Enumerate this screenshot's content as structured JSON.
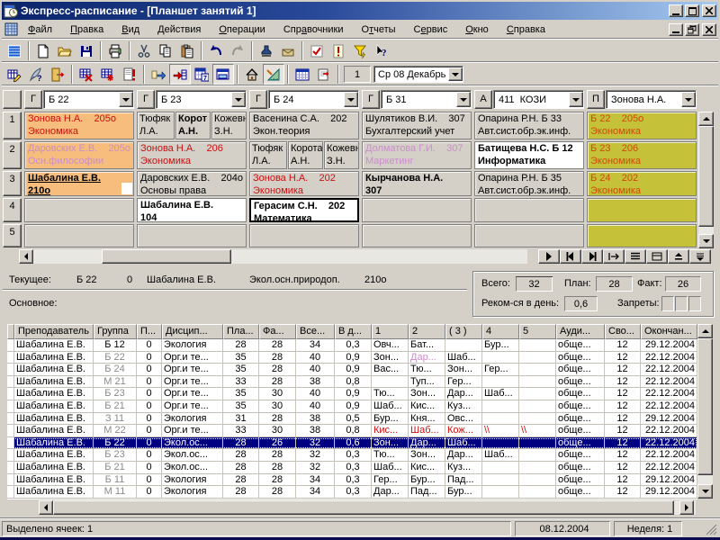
{
  "titlebar": {
    "title": "Экспресс-расписание - [Планшет занятий 1]",
    "icon": "app-icon",
    "buttons": [
      "minimize-button",
      "maximize-button",
      "close-button"
    ]
  },
  "menubar": {
    "icon": "child-window-icon",
    "items": [
      {
        "label": "Файл",
        "hot": 0
      },
      {
        "label": "Правка",
        "hot": 0
      },
      {
        "label": "Вид",
        "hot": 0
      },
      {
        "label": "Действия",
        "hot": 0
      },
      {
        "label": "Операции",
        "hot": 0
      },
      {
        "label": "Справочники",
        "hot": 3
      },
      {
        "label": "Отчеты",
        "hot": 1
      },
      {
        "label": "Сервис",
        "hot": 1
      },
      {
        "label": "Окно",
        "hot": 0
      },
      {
        "label": "Справка",
        "hot": 0
      }
    ],
    "mdi_buttons": [
      "mdi-minimize-button",
      "mdi-restore-button",
      "mdi-close-button"
    ]
  },
  "toolbar_main": {
    "icons": [
      "view-list-icon",
      "|",
      "new-document-icon",
      "open-folder-icon",
      "save-icon",
      "|",
      "print-icon",
      "|",
      "cut-icon",
      "copy-icon",
      "paste-icon",
      "|",
      "undo-icon",
      "redo-icon",
      "|",
      "stamp-icon",
      "send-icon",
      "|",
      "check-task-icon",
      "alert-doc-icon",
      "filter-icon",
      "help-pointer-icon"
    ]
  },
  "toolbar_schedule": {
    "icons": [
      "grid-edit-icon",
      "quill-icon",
      "exit-door-icon",
      "|",
      "grid-delete-icon",
      "grid-clear-icon",
      "doc-warning-icon",
      "|",
      "move-lesson-icon",
      "move-lesson-next-icon*",
      "calendar-day-icon",
      "window-panel-icon*",
      "|",
      "home-icon",
      "ruler-icon*",
      "|",
      "calendar-grid-icon",
      "sheet-settings-icon",
      "|"
    ],
    "lesson_number": "1",
    "date_value": "Ср 08 Декабрь"
  },
  "schedule": {
    "columns": [
      {
        "btn": "Г",
        "value": "Б 22"
      },
      {
        "btn": "Г",
        "value": "Б 23"
      },
      {
        "btn": "Г",
        "value": "Б 24"
      },
      {
        "btn": "Г",
        "value": "Б 31"
      },
      {
        "btn": "А",
        "value": "411  КОЗИ"
      },
      {
        "btn": "П",
        "value": "Зонова Н.А."
      }
    ],
    "rows": [
      {
        "num": "1",
        "cells": [
          {
            "lines": [
              "Зонова Н.А.    205о",
              "Экономика"
            ],
            "bg": "peach",
            "fg": "red"
          },
          {
            "split": [
              {
                "lines": [
                  "Тюфяк",
                  "Л.А."
                ]
              },
              {
                "lines": [
                  "Корот",
                  "А.Н."
                ],
                "bold": true
              },
              {
                "lines": [
                  "Кожевн",
                  "З.Н."
                ]
              }
            ]
          },
          {
            "lines": [
              "Васенина С.А.    202",
              "Экон.теория"
            ]
          },
          {
            "lines": [
              "Шулятиков В.И.    307",
              "Бухгалтерский учет"
            ]
          },
          {
            "lines": [
              "Опарина Р.Н. Б 33",
              "Авт.сист.обр.эк.инф."
            ]
          },
          {
            "lines": [
              "Б 22    205о",
              "Экономика"
            ],
            "bg": "olive",
            "fg": "rust"
          }
        ]
      },
      {
        "num": "2",
        "cells": [
          {
            "lines": [
              "Даровских Е.В.    205о",
              "Осн.философии"
            ],
            "bg": "peach",
            "fg": "pink"
          },
          {
            "lines": [
              "Зонова Н.А.    206",
              "Экономика"
            ],
            "fg": "red"
          },
          {
            "split": [
              {
                "lines": [
                  "Тюфяк",
                  "Л.А."
                ]
              },
              {
                "lines": [
                  "Корота",
                  "А.Н."
                ]
              },
              {
                "lines": [
                  "Кожевн",
                  "З.Н."
                ]
              }
            ]
          },
          {
            "lines": [
              "Долматова Г.И.    307",
              "Маркетинг"
            ],
            "fg": "pink"
          },
          {
            "lines": [
              "Батищева Н.С. Б 12",
              "Информатика"
            ],
            "bg": "white",
            "bold": true
          },
          {
            "lines": [
              "Б 23    206",
              "Экономика"
            ],
            "bg": "olive",
            "fg": "rust"
          }
        ]
      },
      {
        "num": "3",
        "cells": [
          {
            "lines": [
              "Шабалина Е.В.",
              "210о"
            ],
            "bg": "peach",
            "bold": true,
            "underline": true,
            "marker": true
          },
          {
            "lines": [
              "Даровских Е.В.    204о",
              "Основы права"
            ]
          },
          {
            "lines": [
              "Зонова Н.А.    202",
              "Экономика"
            ],
            "fg": "red"
          },
          {
            "lines": [
              "Кырчанова Н.А.",
              "307"
            ],
            "bold": true
          },
          {
            "lines": [
              "Опарина Р.Н. Б 35",
              "Авт.сист.обр.эк.инф."
            ]
          },
          {
            "lines": [
              "Б 24    202",
              "Экономика"
            ],
            "bg": "olive",
            "fg": "rust"
          }
        ]
      },
      {
        "num": "4",
        "cells": [
          {},
          {
            "lines": [
              "Шабалина Е.В.",
              "104"
            ],
            "bg": "white",
            "bold": true
          },
          {
            "lines": [
              "Герасим С.Н.    202",
              "Математика"
            ],
            "bg": "white",
            "bold": true,
            "frame": true
          },
          {},
          {},
          {
            "bg": "olive"
          }
        ]
      },
      {
        "num": "5",
        "cells": [
          {},
          {},
          {},
          {},
          {},
          {
            "bg": "olive"
          }
        ]
      }
    ],
    "nav_icons": [
      "play-icon",
      "step-back-icon",
      "step-forward-icon",
      "goto-lesson-icon",
      "list-view-icon",
      "panel-view-icon",
      "collapse-up-icon",
      "collapse-down-icon"
    ]
  },
  "current": {
    "label": "Текущее:",
    "group": "Б 22",
    "shift": "0",
    "teacher": "Шабалина Е.В.",
    "subject": "Экол.осн.природоп.",
    "room": "210о"
  },
  "stats": {
    "total_label": "Всего:",
    "total": "32",
    "plan_label": "План:",
    "plan": "28",
    "fact_label": "Факт:",
    "fact": "26",
    "per_day_label": "Реком-ся в день:",
    "per_day": "0,6",
    "bans_label": "Запреты:"
  },
  "section_label": "Основное:",
  "grid_table": {
    "headers": [
      "Преподаватель",
      "Группа",
      "П...",
      "Дисцип...",
      "Пла...",
      "Фа...",
      "Все...",
      "В д...",
      "1",
      "2",
      "( 3 )",
      "4",
      "5",
      "Ауди...",
      "Сво...",
      "Окончан..."
    ],
    "rows": [
      {
        "c": [
          "Шабалина Е.В.",
          "Б 12",
          "0",
          "Экология",
          "28",
          "28",
          "34",
          "0,3",
          "Овч...",
          "Бат...",
          "",
          "Бур...",
          "",
          "обще...",
          "12",
          "29.12.2004"
        ],
        "grayGroup": false
      },
      {
        "c": [
          "Шабалина Е.В.",
          "Б 22",
          "0",
          "Орг.и те...",
          "35",
          "28",
          "40",
          "0,9",
          "Зон...",
          "Дар...",
          "Шаб...",
          "",
          "",
          "обще...",
          "12",
          "22.12.2004"
        ],
        "grayGroup": true,
        "pinkCols": [
          9
        ]
      },
      {
        "c": [
          "Шабалина Е.В.",
          "Б 24",
          "0",
          "Орг.и те...",
          "35",
          "28",
          "40",
          "0,9",
          "Вас...",
          "Тю...",
          "Зон...",
          "Гер...",
          "",
          "обще...",
          "12",
          "22.12.2004"
        ],
        "grayGroup": true
      },
      {
        "c": [
          "Шабалина Е.В.",
          "М 21",
          "0",
          "Орг.и те...",
          "33",
          "28",
          "38",
          "0,8",
          "",
          "Туп...",
          "Гер...",
          "",
          "",
          "обще...",
          "12",
          "22.12.2004"
        ],
        "grayGroup": true
      },
      {
        "c": [
          "Шабалина Е.В.",
          "Б 23",
          "0",
          "Орг.и те...",
          "35",
          "30",
          "40",
          "0,9",
          "Тю...",
          "Зон...",
          "Дар...",
          "Шаб...",
          "",
          "обще...",
          "12",
          "22.12.2004"
        ],
        "grayGroup": true
      },
      {
        "c": [
          "Шабалина Е.В.",
          "Б 21",
          "0",
          "Орг.и те...",
          "35",
          "30",
          "40",
          "0,9",
          "Шаб...",
          "Кис...",
          "Куз...",
          "",
          "",
          "обще...",
          "12",
          "22.12.2004"
        ],
        "grayGroup": true
      },
      {
        "c": [
          "Шабалина Е.В.",
          "З 11",
          "0",
          "Экология",
          "31",
          "28",
          "38",
          "0,5",
          "Бур...",
          "Кня...",
          "Овс...",
          "",
          "",
          "обще...",
          "12",
          "29.12.2004"
        ],
        "grayGroup": true
      },
      {
        "c": [
          "Шабалина Е.В.",
          "М 22",
          "0",
          "Орг.и те...",
          "33",
          "30",
          "38",
          "0,8",
          "Кис...",
          "Шаб...",
          "Кож...",
          "\\\\",
          "\\\\",
          "обще...",
          "12",
          "22.12.2004"
        ],
        "grayGroup": true,
        "redCols": [
          8,
          9,
          10,
          11,
          12
        ]
      },
      {
        "c": [
          "Шабалина Е.В.",
          "Б 22",
          "0",
          "Экол.ос...",
          "28",
          "26",
          "32",
          "0,6",
          "Зон...",
          "Дар...",
          "Шаб...",
          "",
          "",
          "обще...",
          "12",
          "22.12.2004"
        ],
        "selected": true
      },
      {
        "c": [
          "Шабалина Е.В.",
          "Б 23",
          "0",
          "Экол.ос...",
          "28",
          "28",
          "32",
          "0,3",
          "Тю...",
          "Зон...",
          "Дар...",
          "Шаб...",
          "",
          "обще...",
          "12",
          "22.12.2004"
        ],
        "grayGroup": true
      },
      {
        "c": [
          "Шабалина Е.В.",
          "Б 21",
          "0",
          "Экол.ос...",
          "28",
          "28",
          "32",
          "0,3",
          "Шаб...",
          "Кис...",
          "Куз...",
          "",
          "",
          "обще...",
          "12",
          "22.12.2004"
        ],
        "grayGroup": true
      },
      {
        "c": [
          "Шабалина Е.В.",
          "Б 11",
          "0",
          "Экология",
          "28",
          "28",
          "34",
          "0,3",
          "Гер...",
          "Бур...",
          "Пад...",
          "",
          "",
          "обще...",
          "12",
          "29.12.2004"
        ],
        "grayGroup": true
      },
      {
        "c": [
          "Шабалина Е.В.",
          "М 11",
          "0",
          "Экология",
          "28",
          "28",
          "34",
          "0,3",
          "Дар...",
          "Пад...",
          "Бур...",
          "",
          "",
          "обще...",
          "12",
          "29.12.2004"
        ],
        "grayGroup": true
      }
    ]
  },
  "statusbar": {
    "left": "Выделено ячеек: 1",
    "date": "08.12.2004",
    "week": "Неделя: 1"
  }
}
